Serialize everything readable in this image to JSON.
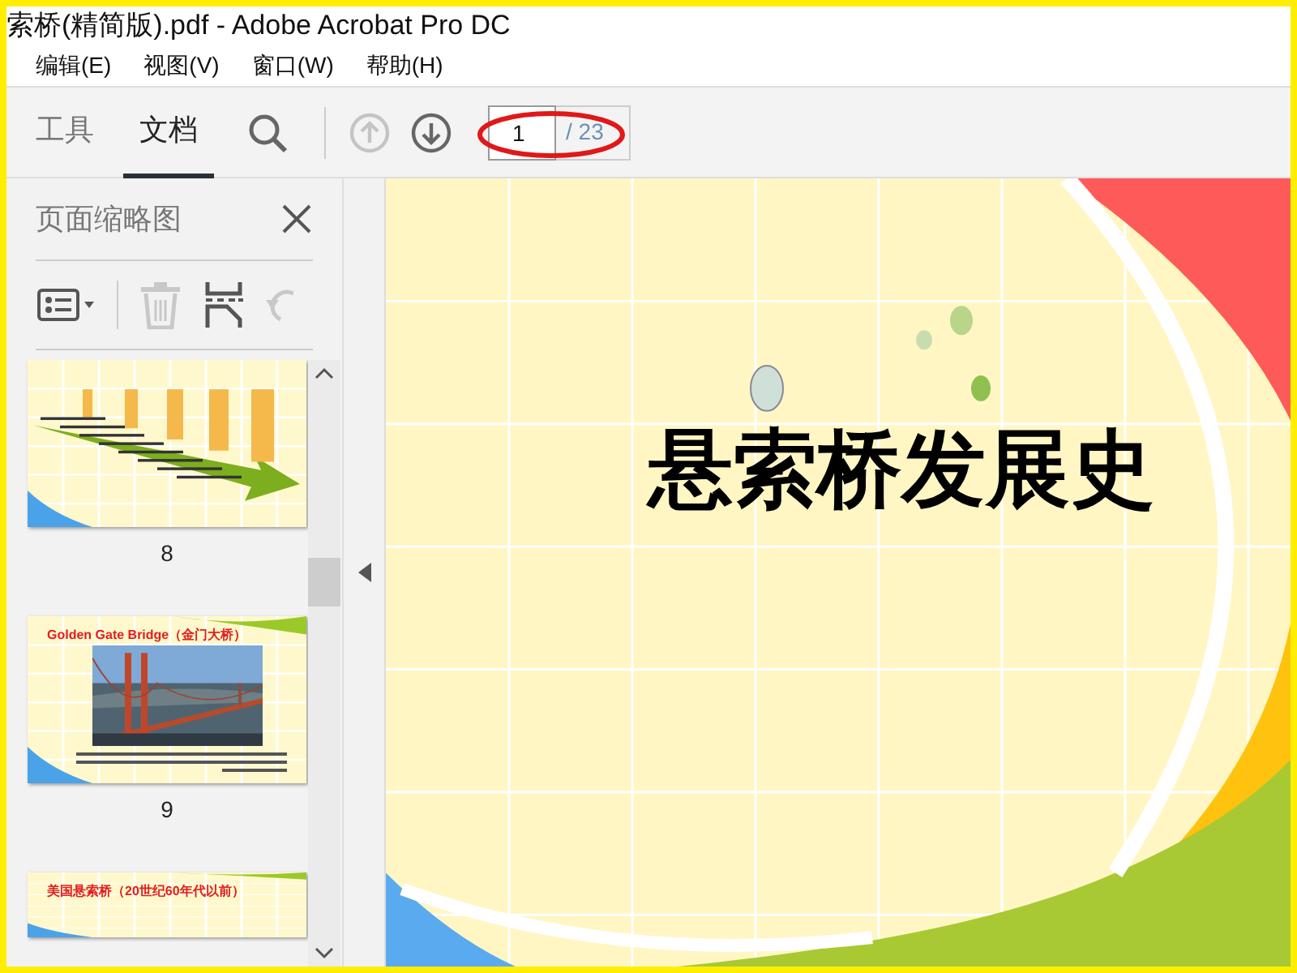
{
  "window": {
    "title": "索桥(精简版).pdf - Adobe Acrobat Pro DC"
  },
  "menu": [
    "编辑(E)",
    "视图(V)",
    "窗口(W)",
    "帮助(H)"
  ],
  "tabs": [
    {
      "label": "工具",
      "selected": false
    },
    {
      "label": "文档",
      "selected": true
    }
  ],
  "nav_buttons": [
    {
      "kind": "up",
      "disabled": true
    },
    {
      "kind": "down",
      "disabled": false
    }
  ],
  "page_field": {
    "value": "1",
    "total": "/ 23"
  },
  "sidebar": {
    "title": "页面缩略图",
    "tools": [
      {
        "kind": "options",
        "disabled": false
      },
      {
        "kind": "delete",
        "disabled": true
      },
      {
        "kind": "extract",
        "disabled": false
      },
      {
        "kind": "rotate",
        "disabled": true
      }
    ],
    "thumbnails": [
      {
        "kind": "chart",
        "label": "8"
      },
      {
        "heading": "Golden Gate Bridge（金门大桥）",
        "label": "9"
      },
      {
        "heading": "美国悬索桥（20世纪60年代以前）"
      }
    ]
  },
  "slide": {
    "title": "悬索桥发展史"
  }
}
